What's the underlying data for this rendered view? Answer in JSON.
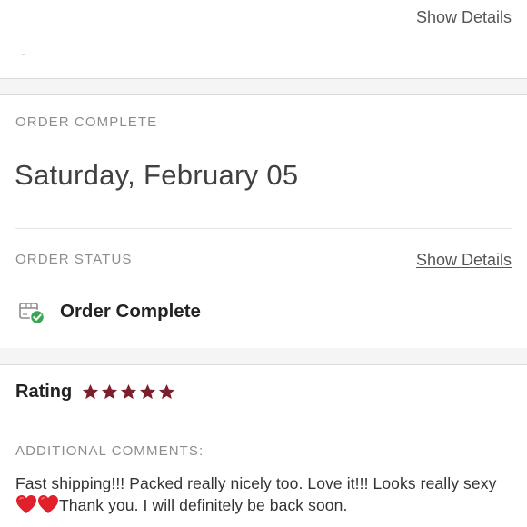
{
  "top_card": {
    "link_label": "Show Details"
  },
  "order_card": {
    "completion_label": "ORDER COMPLETE",
    "date": "Saturday, February 05",
    "status_label": "ORDER STATUS",
    "status_link_label": "Show Details",
    "status_icon": "package-check-icon",
    "status_value": "Order Complete"
  },
  "rating_card": {
    "title": "Rating",
    "stars": 5,
    "max_stars": 5,
    "star_color": "#7a1f2b",
    "comments_label": "ADDITIONAL COMMENTS:",
    "comment_part1": "Fast shipping!!! Packed really nicely too. Love it!!! Looks really sexy ",
    "comment_icons": [
      "red-heart-icon",
      "red-heart-icon"
    ],
    "comment_part2": "Thank you. I will definitely be back soon."
  },
  "colors": {
    "accent_green": "#3aa655",
    "heart_red": "#e0202a",
    "label_gray": "#8c8c8c"
  }
}
